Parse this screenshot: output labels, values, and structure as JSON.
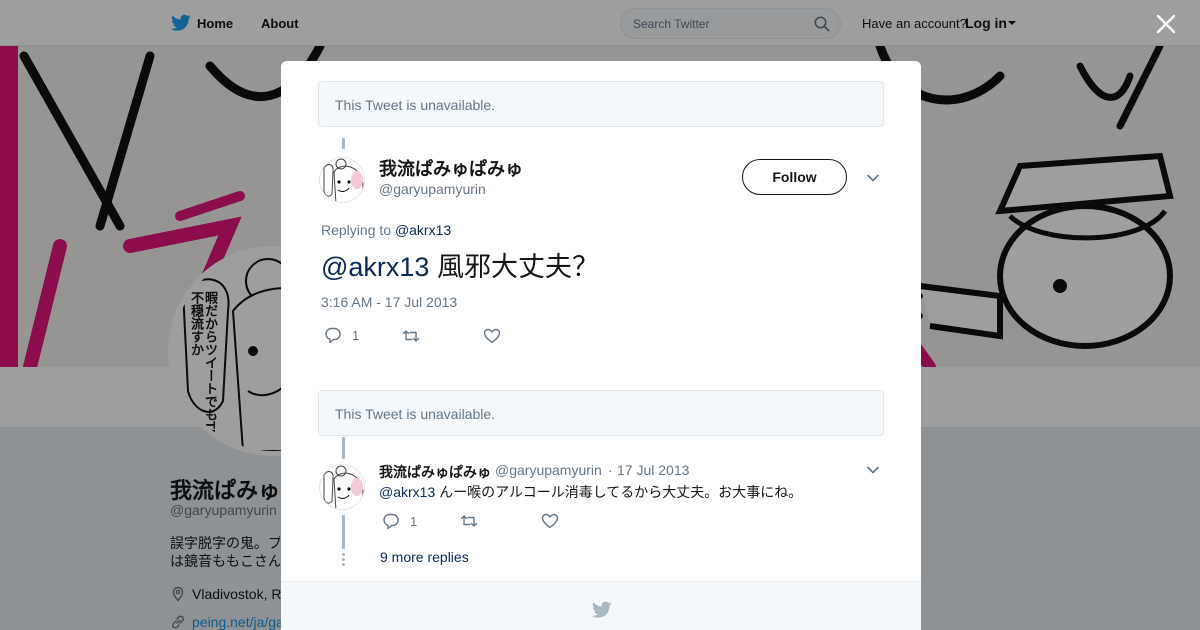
{
  "topbar": {
    "home_label": "Home",
    "about_label": "About",
    "search_placeholder": "Search Twitter",
    "have_account": "Have an account?",
    "login_label": "Log in",
    "brand_color": "#1da1f2"
  },
  "profile": {
    "name": "我流ぱみゅぱみゅ",
    "handle": "@garyupamyurin",
    "bio": "誤字脱字の鬼。プ\nは鏡音ももこさん",
    "location": "Vladivostok, R",
    "link": "peing.net/ja/ga",
    "avatar_caption": "暇だからツイートでもTLに不穏流すか",
    "banner_accent": "#e0157a"
  },
  "modal": {
    "unavailable_1": "This Tweet is unavailable.",
    "unavailable_2": "This Tweet is unavailable.",
    "main_tweet": {
      "name": "我流ぱみゅぱみゅ",
      "handle": "@garyupamyurin",
      "follow_label": "Follow",
      "replying_prefix": "Replying to",
      "replying_handle": "@akrx13",
      "mention": "@akrx13",
      "text": "風邪大丈夫？",
      "timestamp": "3:16 AM - 17 Jul 2013",
      "reply_count": "1",
      "retweet_count": "",
      "like_count": ""
    },
    "reply_tweet": {
      "name": "我流ぱみゅぱみゅ",
      "handle": "@garyupamyurin",
      "separator": "·",
      "date": "17 Jul 2013",
      "mention": "@akrx13",
      "text": "んー喉のアルコール消毒してるから大丈夫。お大事にね。",
      "reply_count": "1",
      "retweet_count": "",
      "like_count": ""
    },
    "more_replies": "9 more replies"
  },
  "icons": {
    "logo": "twitter-bird-icon",
    "search": "search-icon",
    "close": "close-icon",
    "reply": "reply-icon",
    "retweet": "retweet-icon",
    "like": "heart-icon",
    "chevron": "chevron-down-icon",
    "location": "location-pin-icon",
    "link": "link-icon"
  }
}
